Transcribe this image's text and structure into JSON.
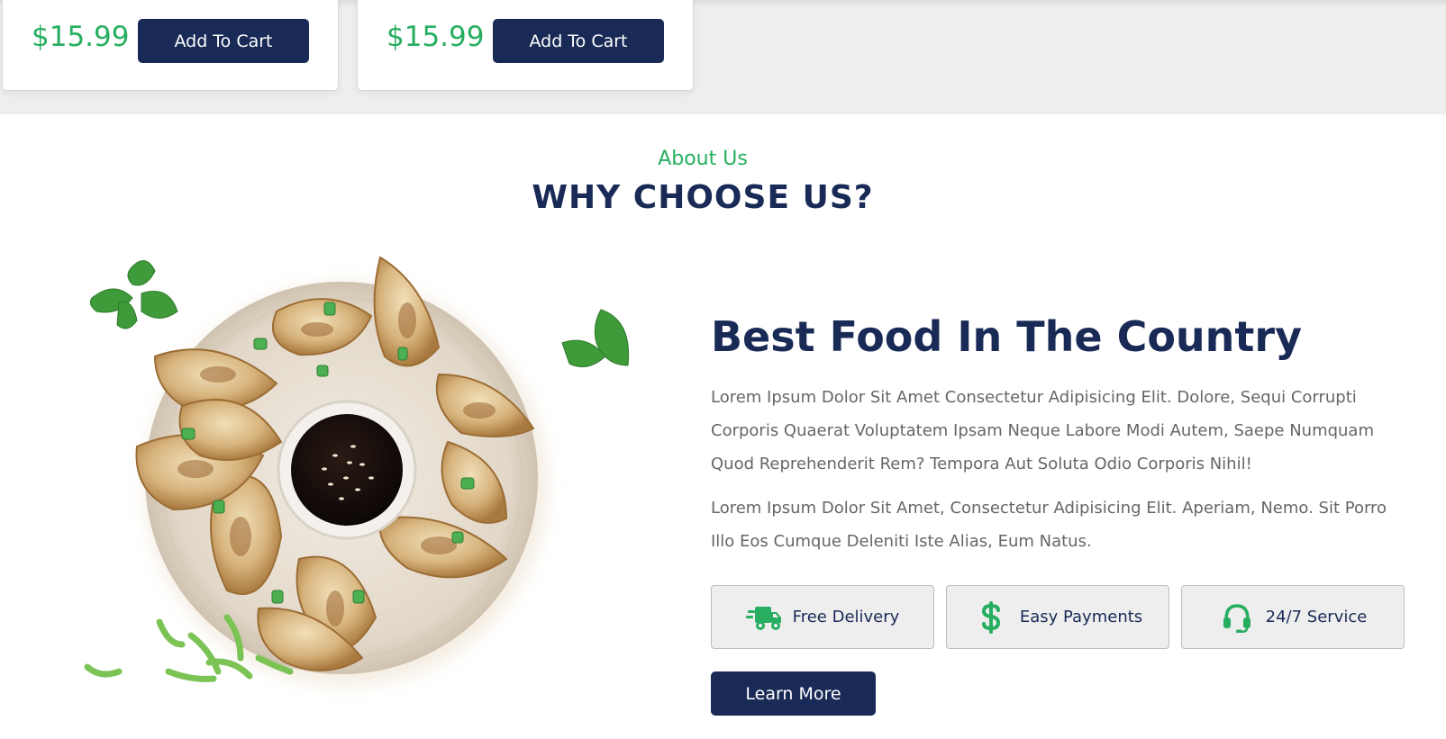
{
  "products": [
    {
      "price": "$15.99",
      "button_label": "Add To Cart"
    },
    {
      "price": "$15.99",
      "button_label": "Add To Cart"
    }
  ],
  "about": {
    "subheading": "About Us",
    "heading": "WHY CHOOSE US?",
    "content_title": "Best Food In The Country",
    "paragraph_1": "Lorem Ipsum Dolor Sit Amet Consectetur Adipisicing Elit. Dolore, Sequi Corrupti Corporis Quaerat Voluptatem Ipsam Neque Labore Modi Autem, Saepe Numquam Quod Reprehenderit Rem? Tempora Aut Soluta Odio Corporis Nihil!",
    "paragraph_2": "Lorem Ipsum Dolor Sit Amet, Consectetur Adipisicing Elit. Aperiam, Nemo. Sit Porro Illo Eos Cumque Deleniti Iste Alias, Eum Natus.",
    "features": [
      {
        "label": "Free Delivery",
        "icon": "shipping-fast-icon"
      },
      {
        "label": "Easy Payments",
        "icon": "dollar-sign-icon"
      },
      {
        "label": "24/7 Service",
        "icon": "headset-icon"
      }
    ],
    "learn_more_label": "Learn More"
  },
  "colors": {
    "primary": "#192a56",
    "accent": "#27ae60",
    "text_muted": "#666666",
    "light_bg": "#eeeeee"
  }
}
